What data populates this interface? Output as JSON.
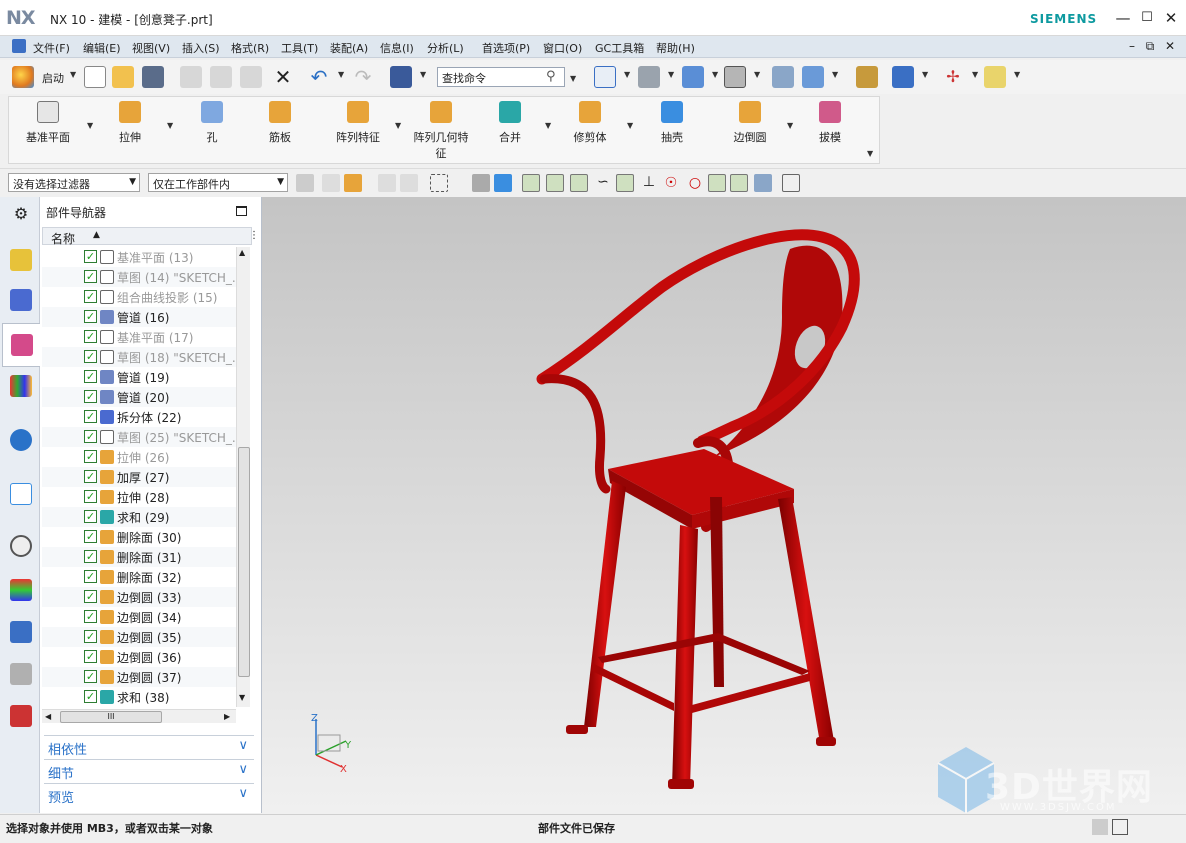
{
  "window": {
    "logo": "NX",
    "title": "NX 10 - 建模 - [创意凳子.prt]",
    "brand": "SIEMENS",
    "controls": [
      "minimize",
      "maximize",
      "close"
    ]
  },
  "menubar": {
    "items": [
      "文件(F)",
      "编辑(E)",
      "视图(V)",
      "插入(S)",
      "格式(R)",
      "工具(T)",
      "装配(A)",
      "信息(I)",
      "分析(L)",
      "首选项(P)",
      "窗口(O)",
      "GC工具箱",
      "帮助(H)"
    ]
  },
  "toolbar": {
    "start_label": "启动",
    "search_placeholder": "查找命令"
  },
  "ribbon": {
    "items": [
      "基准平面",
      "拉伸",
      "孔",
      "筋板",
      "阵列特征",
      "阵列几何特",
      "征",
      "合并",
      "修剪体",
      "抽壳",
      "边倒圆",
      "拔模"
    ]
  },
  "selection_bar": {
    "filter": "没有选择过滤器",
    "scope": "仅在工作部件内"
  },
  "navigator": {
    "title": "部件导航器",
    "column": "名称",
    "rows": [
      {
        "label": "基准平面 (13)",
        "icon": "datum-plane-icon",
        "suppressed": true
      },
      {
        "label": "草图 (14) \"SKETCH_...",
        "icon": "sketch-icon",
        "suppressed": true
      },
      {
        "label": "组合曲线投影 (15)",
        "icon": "projection-icon",
        "suppressed": true
      },
      {
        "label": "管道 (16)",
        "icon": "tube-icon",
        "suppressed": false
      },
      {
        "label": "基准平面 (17)",
        "icon": "datum-plane-icon",
        "suppressed": true
      },
      {
        "label": "草图 (18) \"SKETCH_...",
        "icon": "sketch-icon",
        "suppressed": true
      },
      {
        "label": "管道 (19)",
        "icon": "tube-icon",
        "suppressed": false
      },
      {
        "label": "管道 (20)",
        "icon": "tube-icon",
        "suppressed": false
      },
      {
        "label": "拆分体 (22)",
        "icon": "split-body-icon",
        "suppressed": false
      },
      {
        "label": "草图 (25) \"SKETCH_...",
        "icon": "sketch-icon",
        "suppressed": true
      },
      {
        "label": "拉伸 (26)",
        "icon": "extrude-icon",
        "suppressed": true
      },
      {
        "label": "加厚 (27)",
        "icon": "thicken-icon",
        "suppressed": false
      },
      {
        "label": "拉伸 (28)",
        "icon": "extrude-icon",
        "suppressed": false
      },
      {
        "label": "求和 (29)",
        "icon": "unite-icon",
        "suppressed": false
      },
      {
        "label": "删除面 (30)",
        "icon": "delete-face-icon",
        "suppressed": false
      },
      {
        "label": "删除面 (31)",
        "icon": "delete-face-icon",
        "suppressed": false
      },
      {
        "label": "删除面 (32)",
        "icon": "delete-face-icon",
        "suppressed": false
      },
      {
        "label": "边倒圆 (33)",
        "icon": "edge-blend-icon",
        "suppressed": false
      },
      {
        "label": "边倒圆 (34)",
        "icon": "edge-blend-icon",
        "suppressed": false
      },
      {
        "label": "边倒圆 (35)",
        "icon": "edge-blend-icon",
        "suppressed": false
      },
      {
        "label": "边倒圆 (36)",
        "icon": "edge-blend-icon",
        "suppressed": false
      },
      {
        "label": "边倒圆 (37)",
        "icon": "edge-blend-icon",
        "suppressed": false
      },
      {
        "label": "求和 (38)",
        "icon": "unite-icon",
        "suppressed": false
      }
    ],
    "hscroll_label": "III",
    "sections": [
      "相依性",
      "细节",
      "预览"
    ]
  },
  "viewport": {
    "model_color": "#c40a0a",
    "triad": {
      "z": "Z",
      "y": "Y",
      "x": "X"
    }
  },
  "watermark": {
    "main": "3D世界网",
    "sub": "WWW.3DSJW.COM"
  },
  "status": {
    "left": "选择对象并使用 MB3，或者双击某一对象",
    "center": "部件文件已保存"
  }
}
